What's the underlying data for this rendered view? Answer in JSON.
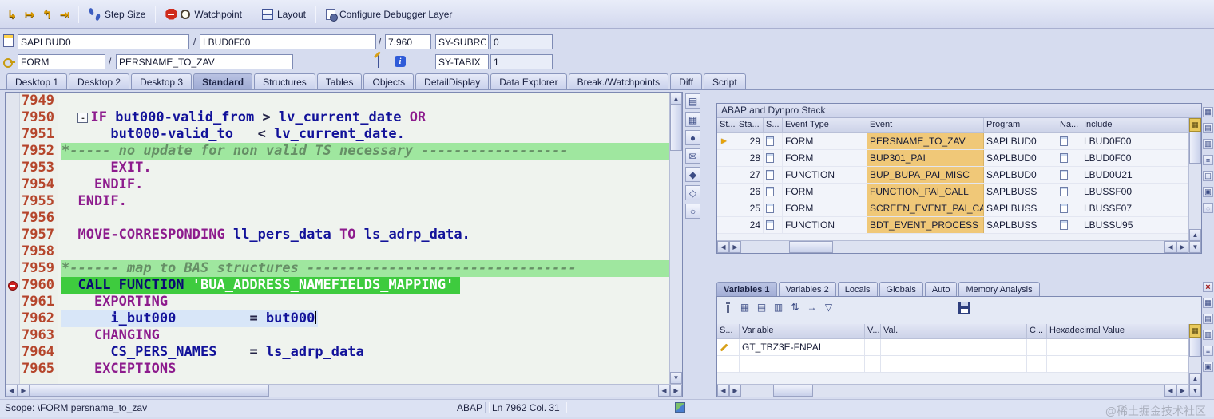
{
  "toolbar": {
    "step_size": "Step Size",
    "watchpoint": "Watchpoint",
    "layout": "Layout",
    "configure": "Configure Debugger Layer"
  },
  "icons": {
    "step_into": "↳",
    "step_over": "↦",
    "step_return": "↰",
    "continue": "⇥",
    "scroll_up": "▲",
    "scroll_down": "▼",
    "scroll_left": "◀",
    "scroll_right": "▶",
    "current_row": "►",
    "config": "▦",
    "info": "i",
    "close": "×",
    "sort": "⇅",
    "navigate": "→",
    "filter": "▽",
    "table": "▦",
    "list": "▤",
    "columns": "▥"
  },
  "fields": {
    "program": "SAPLBUD0",
    "include": "LBUD0F00",
    "line": "7.960",
    "separator": "/",
    "sy_subrc_label": "SY-SUBRC",
    "sy_subrc_value": "0",
    "event_type": "FORM",
    "event_name": "PERSNAME_TO_ZAV",
    "sy_tabix_label": "SY-TABIX",
    "sy_tabix_value": "1"
  },
  "desktop_tabs": [
    {
      "label": "Desktop 1",
      "active": false
    },
    {
      "label": "Desktop 2",
      "active": false
    },
    {
      "label": "Desktop 3",
      "active": false
    },
    {
      "label": "Standard",
      "active": true
    },
    {
      "label": "Structures",
      "active": false
    },
    {
      "label": "Tables",
      "active": false
    },
    {
      "label": "Objects",
      "active": false
    },
    {
      "label": "DetailDisplay",
      "active": false
    },
    {
      "label": "Data Explorer",
      "active": false
    },
    {
      "label": "Break./Watchpoints",
      "active": false
    },
    {
      "label": "Diff",
      "active": false
    },
    {
      "label": "Script",
      "active": false
    }
  ],
  "editor": {
    "lines": [
      {
        "num": "7949",
        "segs": []
      },
      {
        "num": "7950",
        "segs": [
          [
            "  ",
            "pl"
          ],
          [
            "-",
            "fold"
          ],
          [
            "IF ",
            "kw"
          ],
          [
            "but000-valid_from ",
            "id"
          ],
          [
            "> ",
            "pl"
          ],
          [
            "lv_current_date ",
            "id"
          ],
          [
            "OR",
            "kw"
          ]
        ]
      },
      {
        "num": "7951",
        "segs": [
          [
            "      ",
            "pl"
          ],
          [
            "but000-valid_to   ",
            "id"
          ],
          [
            "< ",
            "pl"
          ],
          [
            "lv_current_date.",
            "id"
          ]
        ]
      },
      {
        "num": "7952",
        "band": "comment",
        "segs": [
          [
            "*----- no update for non valid TS necessary ------------------",
            "cm"
          ]
        ]
      },
      {
        "num": "7953",
        "segs": [
          [
            "      ",
            "pl"
          ],
          [
            "EXIT.",
            "kw"
          ]
        ]
      },
      {
        "num": "7954",
        "segs": [
          [
            "    ",
            "pl"
          ],
          [
            "ENDIF.",
            "kw"
          ]
        ]
      },
      {
        "num": "7955",
        "segs": [
          [
            "  ",
            "pl"
          ],
          [
            "ENDIF.",
            "kw"
          ]
        ]
      },
      {
        "num": "7956",
        "segs": []
      },
      {
        "num": "7957",
        "segs": [
          [
            "  ",
            "pl"
          ],
          [
            "MOVE-CORRESPONDING ",
            "kw"
          ],
          [
            "ll_pers_data ",
            "id"
          ],
          [
            "TO ",
            "kw"
          ],
          [
            "ls_adrp_data.",
            "id"
          ]
        ]
      },
      {
        "num": "7958",
        "segs": []
      },
      {
        "num": "7959",
        "band": "comment",
        "segs": [
          [
            "*------ map to BAS structures ---------------------------------",
            "cm"
          ]
        ]
      },
      {
        "num": "7960",
        "band": "current",
        "bp": true,
        "segs": [
          [
            "  ",
            "pl"
          ],
          [
            "CALL FUNCTION ",
            "kw"
          ],
          [
            "'BUA_ADDRESS_NAMEFIELDS_MAPPING'",
            "st"
          ]
        ]
      },
      {
        "num": "7961",
        "segs": [
          [
            "    ",
            "pl"
          ],
          [
            "EXPORTING",
            "kw"
          ]
        ]
      },
      {
        "num": "7962",
        "band": "cursor",
        "caret": true,
        "segs": [
          [
            "      ",
            "pl"
          ],
          [
            "i_but000",
            "id"
          ],
          [
            "         ",
            "pl"
          ],
          [
            "= ",
            "pl"
          ],
          [
            "but000",
            "id"
          ]
        ]
      },
      {
        "num": "7963",
        "segs": [
          [
            "    ",
            "pl"
          ],
          [
            "CHANGING",
            "kw"
          ]
        ]
      },
      {
        "num": "7964",
        "segs": [
          [
            "      ",
            "pl"
          ],
          [
            "CS_PERS_NAMES",
            "id"
          ],
          [
            "    ",
            "pl"
          ],
          [
            "= ",
            "pl"
          ],
          [
            "ls_adrp_data",
            "id"
          ]
        ]
      },
      {
        "num": "7965",
        "segs": [
          [
            "    ",
            "pl"
          ],
          [
            "EXCEPTIONS",
            "kw"
          ]
        ]
      }
    ]
  },
  "side_tools": [
    {
      "name": "create-session-icon",
      "glyph": "▤"
    },
    {
      "name": "layout-grid-icon",
      "glyph": "▦"
    },
    {
      "name": "breakpoints-icon",
      "glyph": "●"
    },
    {
      "name": "mail-icon",
      "glyph": "✉"
    },
    {
      "name": "lock-icon",
      "glyph": "◆"
    },
    {
      "name": "unlock-icon",
      "glyph": "◇"
    },
    {
      "name": "search-icon",
      "glyph": "○"
    }
  ],
  "stack": {
    "title": "ABAP and Dynpro Stack",
    "columns": [
      "St...",
      "Sta...",
      "S...",
      "Event Type",
      "Event",
      "Program",
      "Na...",
      "Include"
    ],
    "rows": [
      {
        "current": true,
        "level": "29",
        "event_type": "FORM",
        "event": "PERSNAME_TO_ZAV",
        "program": "SAPLBUD0",
        "include": "LBUD0F00"
      },
      {
        "current": false,
        "level": "28",
        "event_type": "FORM",
        "event": "BUP301_PAI",
        "program": "SAPLBUD0",
        "include": "LBUD0F00"
      },
      {
        "current": false,
        "level": "27",
        "event_type": "FUNCTION",
        "event": "BUP_BUPA_PAI_MISC",
        "program": "SAPLBUD0",
        "include": "LBUD0U21"
      },
      {
        "current": false,
        "level": "26",
        "event_type": "FORM",
        "event": "FUNCTION_PAI_CALL",
        "program": "SAPLBUSS",
        "include": "LBUSSF00"
      },
      {
        "current": false,
        "level": "25",
        "event_type": "FORM",
        "event": "SCREEN_EVENT_PAI_CA..",
        "program": "SAPLBUSS",
        "include": "LBUSSF07"
      },
      {
        "current": false,
        "level": "24",
        "event_type": "FUNCTION",
        "event": "BDT_EVENT_PROCESS",
        "program": "SAPLBUSS",
        "include": "LBUSSU95"
      }
    ]
  },
  "stack_rail": [
    {
      "name": "table-view-icon",
      "glyph": "▦"
    },
    {
      "name": "list-view-icon",
      "glyph": "▤"
    },
    {
      "name": "column-config-icon",
      "glyph": "▥"
    },
    {
      "name": "menu-icon",
      "glyph": "≡"
    },
    {
      "name": "split-view-icon",
      "glyph": "◫"
    },
    {
      "name": "detail-view-icon",
      "glyph": "▣"
    },
    {
      "name": "refresh-icon",
      "glyph": "◌"
    }
  ],
  "variables": {
    "tabs": [
      {
        "label": "Variables 1",
        "active": true
      },
      {
        "label": "Variables 2",
        "active": false
      },
      {
        "label": "Locals",
        "active": false
      },
      {
        "label": "Globals",
        "active": false
      },
      {
        "label": "Auto",
        "active": false
      },
      {
        "label": "Memory Analysis",
        "active": false
      }
    ],
    "columns": [
      "S...",
      "Variable",
      "V...",
      "Val.",
      "C...",
      "Hexadecimal Value"
    ],
    "rows": [
      {
        "variable": "GT_TBZ3E-FNPAI"
      },
      {
        "variable": ""
      }
    ]
  },
  "vars_rail": [
    {
      "name": "close-icon",
      "glyph": "×"
    },
    {
      "name": "table-view-icon",
      "glyph": "▦"
    },
    {
      "name": "list-view-icon",
      "glyph": "▤"
    },
    {
      "name": "column-config-icon",
      "glyph": "▥"
    },
    {
      "name": "menu-icon",
      "glyph": "≡"
    },
    {
      "name": "detail-view-icon",
      "glyph": "▣"
    }
  ],
  "statusbar": {
    "scope": "Scope: \\FORM persname_to_zav",
    "language": "ABAP",
    "position": "Ln 7962 Col. 31"
  },
  "watermark": "@稀土掘金技术社区",
  "colors": {
    "current_statement_bg": "#3ecb3e",
    "comment_bg": "#9fe79f",
    "cursor_line_bg": "#d8e6f8",
    "stack_event_bg": "#f0c878",
    "keyword": "#8d1b8d",
    "identifier": "#12129a",
    "line_number": "#b5452b"
  }
}
